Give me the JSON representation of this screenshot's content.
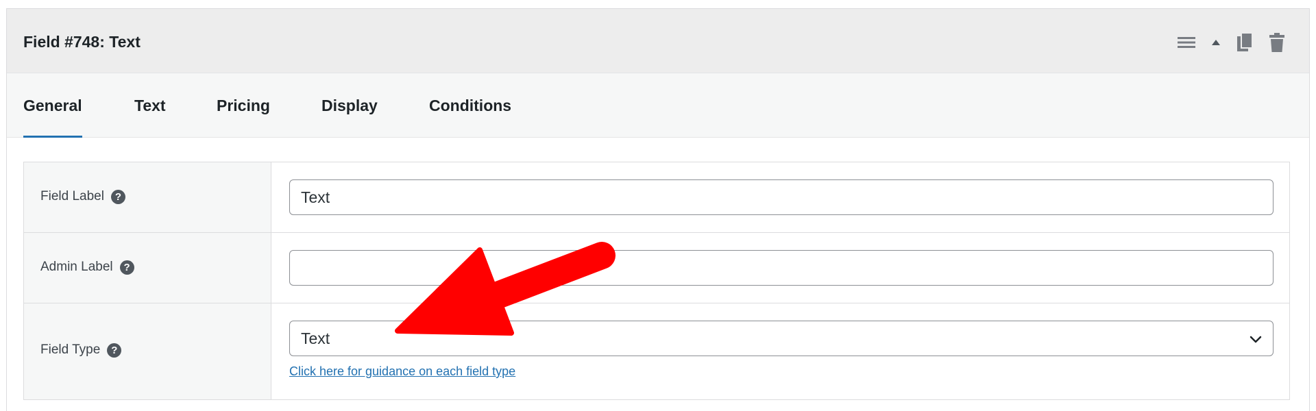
{
  "panel": {
    "title": "Field #748: Text",
    "actions": [
      {
        "icon": "menu-lines-icon"
      },
      {
        "icon": "caret-up-icon"
      },
      {
        "icon": "duplicate-icon"
      },
      {
        "icon": "trash-icon"
      }
    ]
  },
  "tabs": [
    {
      "label": "General",
      "active": true
    },
    {
      "label": "Text",
      "active": false
    },
    {
      "label": "Pricing",
      "active": false
    },
    {
      "label": "Display",
      "active": false
    },
    {
      "label": "Conditions",
      "active": false
    }
  ],
  "fields": {
    "field_label": {
      "label": "Field Label",
      "value": "Text"
    },
    "admin_label": {
      "label": "Admin Label",
      "value": ""
    },
    "field_type": {
      "label": "Field Type",
      "selected": "Text",
      "link_text": "Click here for guidance on each field type"
    }
  },
  "help_glyph": "?",
  "colors": {
    "header_bg": "#ededed",
    "tab_bar_bg": "#f6f7f7",
    "active_tab_underline": "#2271b1",
    "link": "#2271b1",
    "annotation_arrow": "#ff0000"
  }
}
